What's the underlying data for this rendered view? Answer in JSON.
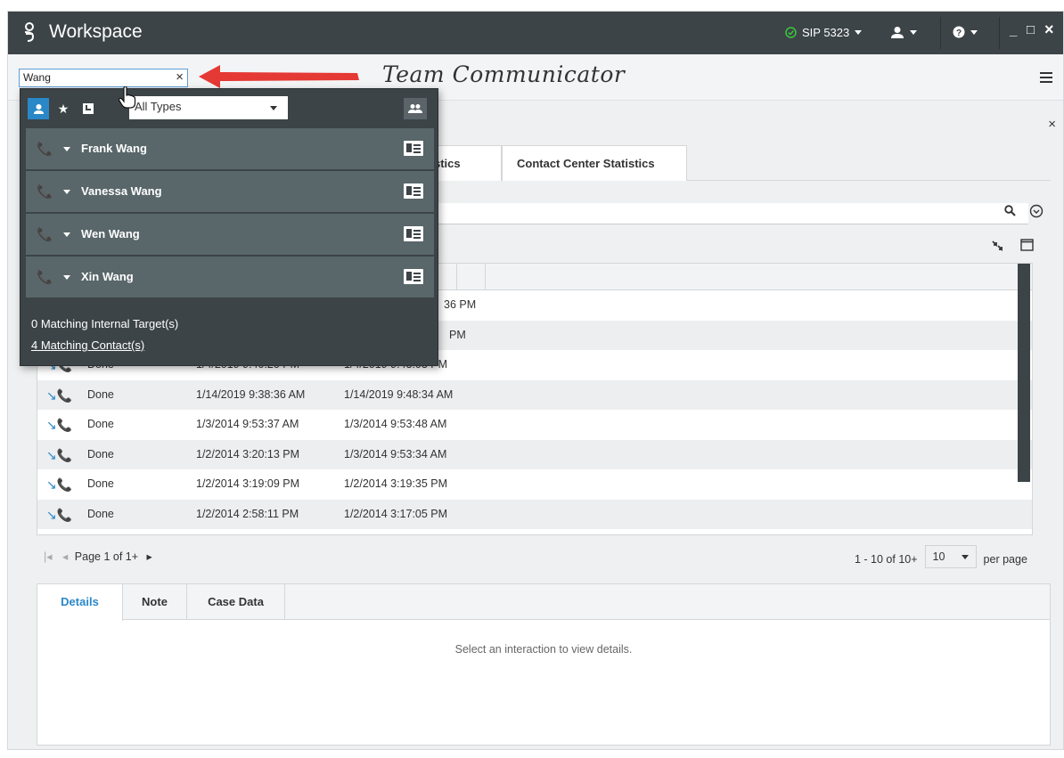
{
  "titlebar": {
    "app_title": "Workspace",
    "status_label": "SIP 5323",
    "status_color": "#3cc83c",
    "agent_icon": "agent-icon",
    "help_icon": "help-icon",
    "minimize": "_",
    "maximize": "□",
    "close": "×"
  },
  "search": {
    "value": "Wang",
    "clear": "×",
    "annotation": "Team Communicator"
  },
  "team_communicator": {
    "type_filter": "All Types",
    "contacts": [
      {
        "name": "Frank Wang"
      },
      {
        "name": "Vanessa Wang"
      },
      {
        "name": "Wen Wang"
      },
      {
        "name": "Xin Wang"
      }
    ],
    "internal_matches": "0 Matching Internal Target(s)",
    "contact_matches": "4 Matching Contact(s)"
  },
  "main": {
    "close": "×",
    "tabs": [
      {
        "label": "stics"
      },
      {
        "label": "Contact Center Statistics"
      }
    ]
  },
  "grid": {
    "rows": [
      {
        "status": "",
        "start": "",
        "end": "36 PM"
      },
      {
        "status": "",
        "start": "",
        "end": "PM"
      },
      {
        "status": "Done",
        "start": "1/4/2019 9:40:20 PM",
        "end": "1/4/2019 9:43:03 PM"
      },
      {
        "status": "Done",
        "start": "1/14/2019 9:38:36 AM",
        "end": "1/14/2019 9:48:34 AM"
      },
      {
        "status": "Done",
        "start": "1/3/2014 9:53:37 AM",
        "end": "1/3/2014 9:53:48 AM"
      },
      {
        "status": "Done",
        "start": "1/2/2014 3:20:13 PM",
        "end": "1/3/2014 9:53:34 AM"
      },
      {
        "status": "Done",
        "start": "1/2/2014 3:19:09 PM",
        "end": "1/2/2014 3:19:35 PM"
      },
      {
        "status": "Done",
        "start": "1/2/2014 2:58:11 PM",
        "end": "1/2/2014 3:17:05 PM"
      }
    ]
  },
  "pager": {
    "page_text": "Page 1 of 1+",
    "range_text": "1 - 10 of 10+",
    "page_size": "10",
    "per_page": "per page"
  },
  "details": {
    "tabs": [
      {
        "label": "Details"
      },
      {
        "label": "Note"
      },
      {
        "label": "Case Data"
      }
    ],
    "empty_message": "Select an interaction to view details."
  }
}
